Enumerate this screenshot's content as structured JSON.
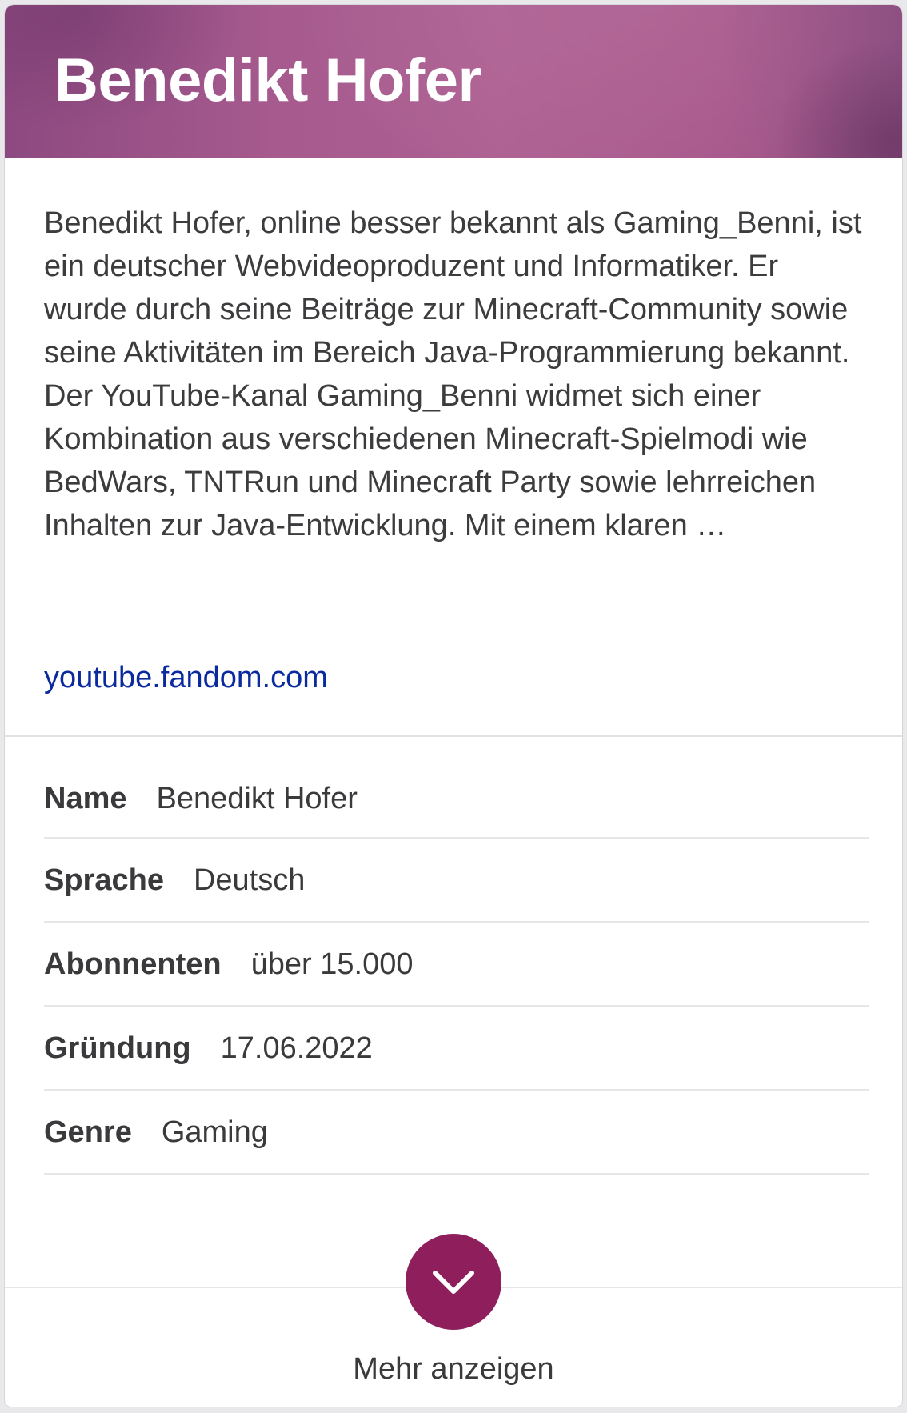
{
  "header": {
    "title": "Benedikt Hofer"
  },
  "summary": {
    "text": "Benedikt Hofer, online besser bekannt als Gaming_Benni, ist ein deutscher Webvideoproduzent und Informatiker. Er wurde durch seine Beiträge zur Minecraft-Community sowie seine Aktivitäten im Bereich Java-Programmierung bekannt. Der YouTube-Kanal Gaming_Benni widmet sich einer Kombination aus verschiedenen Minecraft-Spielmodi wie BedWars, TNTRun und Minecraft Party sowie lehrreichen Inhalten zur Java-Entwicklung. Mit einem klaren …",
    "source": "youtube.fandom.com"
  },
  "facts": [
    {
      "label": "Name",
      "value": "Benedikt Hofer"
    },
    {
      "label": "Sprache",
      "value": "Deutsch"
    },
    {
      "label": "Abonnenten",
      "value": "über 15.000"
    },
    {
      "label": "Gründung",
      "value": "17.06.2022"
    },
    {
      "label": "Genre",
      "value": "Gaming"
    }
  ],
  "footer": {
    "more_label": "Mehr anzeigen",
    "more_icon": "chevron-down-icon"
  },
  "colors": {
    "header_gradient": "#a65a8e",
    "accent_button": "#8e1f5c",
    "link": "#0a2a9e",
    "text": "#3a3a3c"
  }
}
